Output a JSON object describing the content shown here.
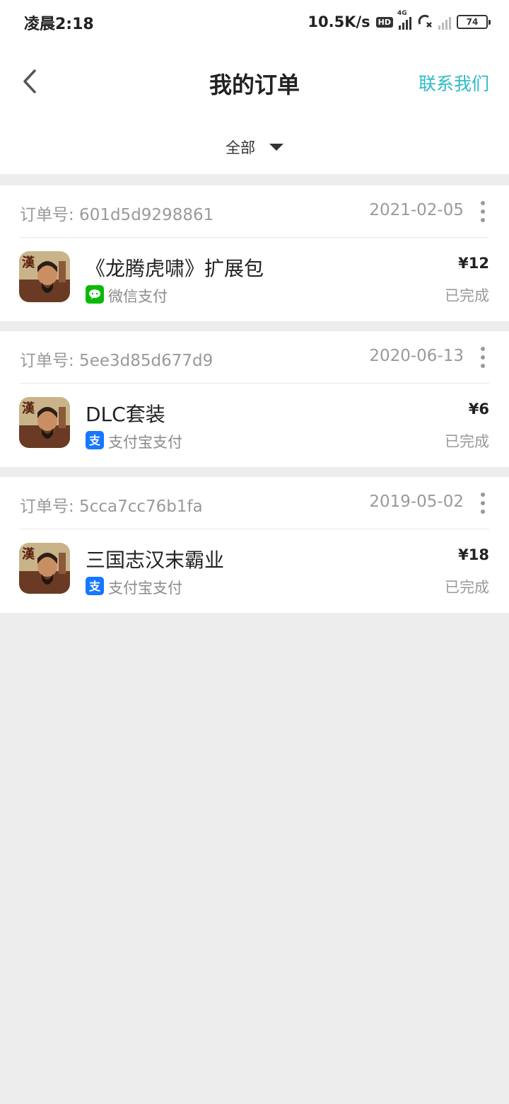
{
  "status_bar": {
    "time": "凌晨2:18",
    "net_speed": "10.5K/s",
    "hd_badge": "HD",
    "network_type": "4G",
    "battery": "74"
  },
  "header": {
    "title": "我的订单",
    "contact": "联系我们"
  },
  "filter": {
    "label": "全部"
  },
  "orders": [
    {
      "order_no": "订单号: 601d5d9298861",
      "date": "2021-02-05",
      "title": "《龙腾虎啸》扩展包",
      "payment": "微信支付",
      "payment_icon": "wechat-pay-icon",
      "price": "¥12",
      "status": "已完成"
    },
    {
      "order_no": "订单号: 5ee3d85d677d9",
      "date": "2020-06-13",
      "title": "DLC套装",
      "payment": "支付宝支付",
      "payment_icon": "alipay-icon",
      "price": "¥6",
      "status": "已完成"
    },
    {
      "order_no": "订单号: 5cca7cc76b1fa",
      "date": "2019-05-02",
      "title": "三国志汉末霸业",
      "payment": "支付宝支付",
      "payment_icon": "alipay-icon",
      "price": "¥18",
      "status": "已完成"
    }
  ],
  "icon_glyph": "漢",
  "colors": {
    "accent": "#2dbcc6",
    "wechat": "#09bb07",
    "alipay": "#1677ff"
  }
}
